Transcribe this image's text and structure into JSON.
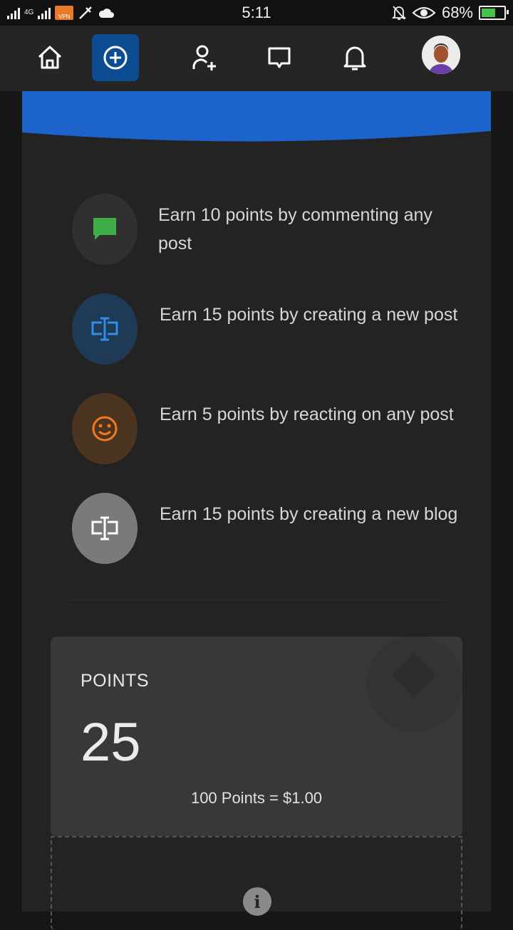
{
  "statusbar": {
    "network": "4G",
    "time": "5:11",
    "battery": "68%",
    "battery_level": 0.68
  },
  "nav": {
    "items": [
      {
        "name": "home-icon"
      },
      {
        "name": "add-circle-icon",
        "active": true
      },
      {
        "name": "add-user-icon"
      },
      {
        "name": "chat-icon"
      },
      {
        "name": "bell-icon"
      },
      {
        "name": "avatar"
      }
    ]
  },
  "earn": {
    "items": [
      {
        "text": "Earn 10 points by commenting any post",
        "icon": "comment-icon",
        "color": "#3fae49",
        "bg": "#2f302f"
      },
      {
        "text": "Earn 15 points by creating a new post",
        "icon": "text-cursor-icon",
        "color": "#2f8fe8",
        "bg": "#1f3a55"
      },
      {
        "text": "Earn 5 points by reacting on any post",
        "icon": "smiley-icon",
        "color": "#f07a22",
        "bg": "#4b3420"
      },
      {
        "text": "Earn 15 points by creating a new blog",
        "icon": "text-cursor-icon",
        "color": "#ffffff",
        "bg": "#7a7a7a"
      }
    ]
  },
  "points": {
    "label": "POINTS",
    "value": "25",
    "rate": "100 Points = $1.00"
  },
  "colors": {
    "banner": "#1c63cc",
    "nav_active": "#0d4b93"
  }
}
